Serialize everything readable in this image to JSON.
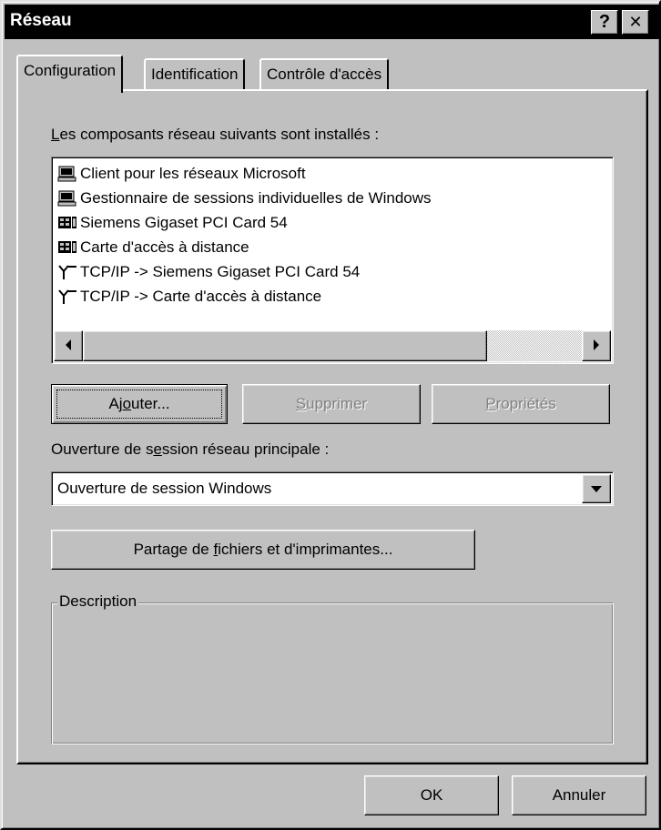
{
  "window": {
    "title": "Réseau",
    "help_label": "?",
    "close_label": "✕"
  },
  "tabs": [
    {
      "label": "Configuration",
      "active": true
    },
    {
      "label": "Identification",
      "active": false
    },
    {
      "label": "Contrôle d'accès",
      "active": false
    }
  ],
  "components": {
    "label_prefix": "L",
    "label_rest": "es composants réseau suivants sont installés :",
    "items": [
      {
        "label": "Client pour les réseaux Microsoft",
        "icon": "network-client-icon"
      },
      {
        "label": "Gestionnaire de sessions individuelles de Windows",
        "icon": "network-client-icon"
      },
      {
        "label": "Siemens Gigaset PCI Card 54",
        "icon": "network-adapter-icon"
      },
      {
        "label": "Carte d'accès à distance",
        "icon": "network-adapter-icon"
      },
      {
        "label": "TCP/IP -> Siemens Gigaset PCI Card 54",
        "icon": "protocol-icon"
      },
      {
        "label": "TCP/IP -> Carte d'accès à distance",
        "icon": "protocol-icon"
      }
    ]
  },
  "buttons": {
    "add_pre": "Aj",
    "add_u": "o",
    "add_post": "uter...",
    "remove_u": "S",
    "remove_post": "upprimer",
    "properties_u": "P",
    "properties_post": "ropriétés",
    "sharing_pre": "Partage de ",
    "sharing_u": "f",
    "sharing_post": "ichiers et d'imprimantes...",
    "ok": "OK",
    "cancel": "Annuler"
  },
  "logon": {
    "label_pre": "Ouverture de s",
    "label_u": "e",
    "label_post": "ssion réseau principale :",
    "selected": "Ouverture de session Windows"
  },
  "description": {
    "label": "Description"
  }
}
